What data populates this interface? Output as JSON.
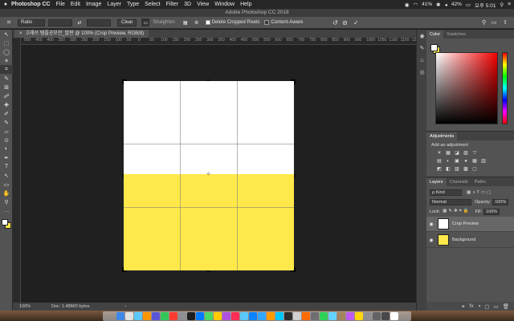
{
  "menubar": {
    "apple": "",
    "app_name": "Photoshop CC",
    "items": [
      "File",
      "Edit",
      "Image",
      "Layer",
      "Type",
      "Select",
      "Filter",
      "3D",
      "View",
      "Window",
      "Help"
    ],
    "battery": "42%",
    "wifi_pct": "41%",
    "input_method": "",
    "clock": "오후 5:01"
  },
  "window_title": "Adobe Photoshop CC 2018",
  "options_bar": {
    "ratio_label": "Ratio",
    "clear_label": "Clear",
    "straighten_label": "Straighten",
    "delete_cropped_label": "Delete Cropped Pixels",
    "delete_cropped_checked": true,
    "content_aware_label": "Content-Aware",
    "content_aware_checked": false,
    "swap_glyph": "⇄",
    "reset_glyph": "↺",
    "cancel_glyph": "⊘",
    "commit_glyph": "✓"
  },
  "document": {
    "tab_title": "고래쓰 템플공모전_발판 @ 100% (Crop Preview, RGB/8)",
    "close_glyph": "×",
    "ruler_marks": [
      "500",
      "450",
      "400",
      "350",
      "300",
      "250",
      "200",
      "150",
      "100",
      "50",
      "0",
      "50",
      "100",
      "150",
      "200",
      "250",
      "300",
      "350",
      "400",
      "450",
      "500",
      "550",
      "600",
      "650",
      "700",
      "750",
      "800",
      "850",
      "900",
      "950",
      "1000",
      "1050",
      "1100",
      "1150",
      "1200"
    ],
    "top_color": "#ffffff",
    "bottom_color": "#ffe94a"
  },
  "status": {
    "zoom": "100%",
    "doc_info": "Doc: 1.48M/0 bytes",
    "arrow": "›"
  },
  "color_panel": {
    "tabs": [
      "Color",
      "Swatches"
    ],
    "foreground": "#ffffff",
    "background": "#ffe94a"
  },
  "adjustments": {
    "title": "Adjustments",
    "subtitle": "Add an adjustment",
    "row1": [
      "☀",
      "▦",
      "◪",
      "▨",
      "▽"
    ],
    "row2": [
      "▤",
      "◐",
      "▣",
      "●",
      "▦",
      "▥"
    ],
    "row3": [
      "◩",
      "◧",
      "▧",
      "▩",
      "▢"
    ]
  },
  "layers": {
    "tabs": [
      "Layers",
      "Channels",
      "Paths"
    ],
    "kind": "ρ Kind",
    "blend_mode": "Normal",
    "opacity_label": "Opacity:",
    "opacity": "100%",
    "lock_label": "Lock:",
    "fill_label": "Fill:",
    "fill": "100%",
    "items": [
      {
        "name": "Crop Preview",
        "thumb": "#ffffff",
        "selected": true
      },
      {
        "name": "Background",
        "thumb": "#ffe94a",
        "selected": false
      }
    ],
    "footer_icons": [
      "⚭",
      "fx",
      "◑",
      "▢",
      "▭",
      "🗑"
    ]
  },
  "tools": [
    "↖",
    "⬚",
    "◯",
    "✶",
    "⌗",
    "✎",
    "⊠",
    "☍",
    "✚",
    "✐",
    "✎",
    "▱",
    "⊙",
    "◐",
    "✒",
    "T",
    "↖",
    "▭",
    "✋",
    "⚲",
    "…"
  ],
  "minidock": [
    "◉",
    "✎",
    "♨",
    "◎"
  ],
  "dock_colors": [
    "#3d88e8",
    "#e1e1e1",
    "#5ac8fa",
    "#ff9500",
    "#5856d6",
    "#34c759",
    "#ff3b30",
    "#8e8e93",
    "#1d1d1f",
    "#007aff",
    "#4cd964",
    "#ffcc00",
    "#af52de",
    "#ff2d55",
    "#5ac8fa",
    "#0a84ff",
    "#31a8ff",
    "#ff9a00",
    "#00c8ff",
    "#2d2d2d",
    "#d0d0d0",
    "#ff6b00",
    "#6e6e73",
    "#30d158",
    "#64d2ff",
    "#a2845e",
    "#bf5af2",
    "#ffd60a",
    "#8e8e93",
    "#636366",
    "#48484a",
    "#ffffff"
  ]
}
